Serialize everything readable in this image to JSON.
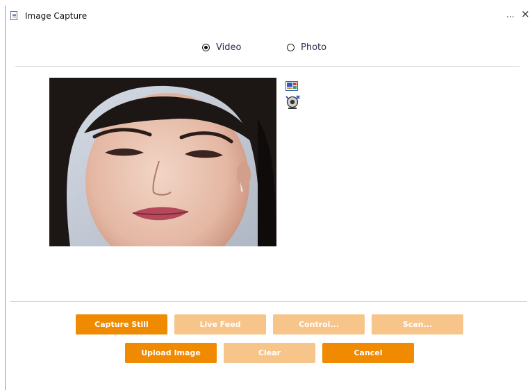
{
  "window": {
    "title": "Image Capture",
    "more_label": "...",
    "close_label": "×"
  },
  "source_selector": {
    "options": [
      {
        "label": "Video",
        "selected": true
      },
      {
        "label": "Photo",
        "selected": false
      }
    ]
  },
  "preview": {
    "tool_icons": [
      "video-source-icon",
      "webcam-settings-icon"
    ]
  },
  "buttons": {
    "capture_still": "Capture Still",
    "live_feed": "Live Feed",
    "control": "Control...",
    "scan": "Scan...",
    "upload_image": "Upload Image",
    "clear": "Clear",
    "cancel": "Cancel"
  },
  "colors": {
    "button_active": "#f08a00",
    "button_disabled": "#f7c48a",
    "radio_label": "#2b2d52"
  }
}
